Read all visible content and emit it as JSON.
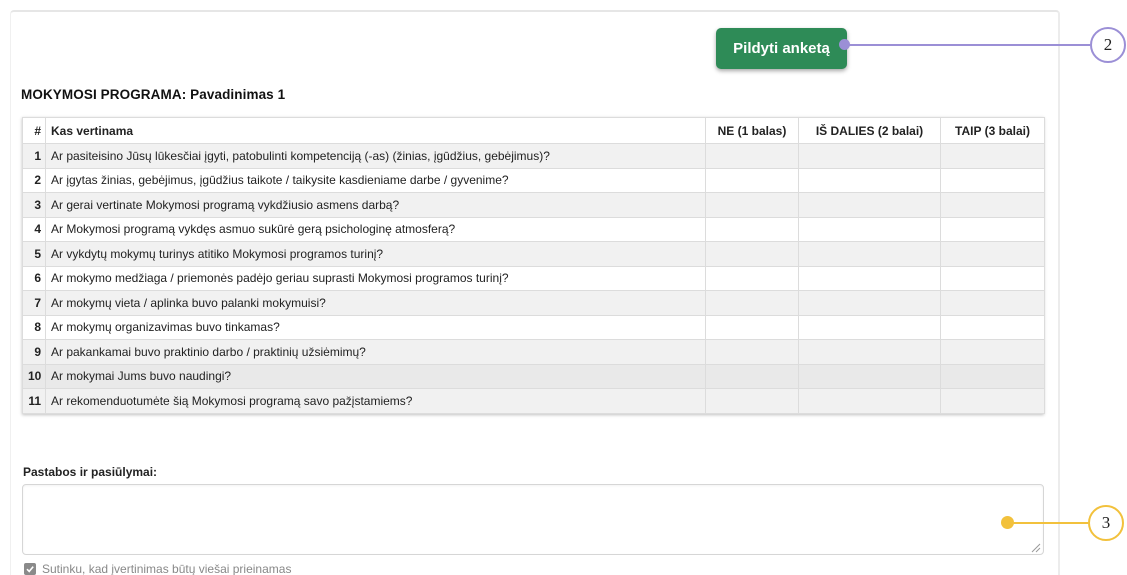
{
  "actions": {
    "fill_button_label": "Pildyti anketą"
  },
  "program": {
    "title": "MOKYMOSI PROGRAMA: Pavadinimas 1"
  },
  "table": {
    "headers": {
      "number": "#",
      "question": "Kas vertinama",
      "opt_no": "NE (1 balas)",
      "opt_partly": "IŠ DALIES (2 balai)",
      "opt_yes": "TAIP (3 balai)"
    },
    "rows": [
      {
        "n": "1",
        "q": "Ar pasiteisino Jūsų lūkesčiai įgyti, patobulinti kompetenciją (-as) (žinias, įgūdžius, gebėjimus)?"
      },
      {
        "n": "2",
        "q": "Ar įgytas žinias, gebėjimus, įgūdžius taikote / taikysite kasdieniame darbe / gyvenime?"
      },
      {
        "n": "3",
        "q": "Ar gerai vertinate Mokymosi programą vykdžiusio asmens darbą?"
      },
      {
        "n": "4",
        "q": "Ar Mokymosi programą vykdęs asmuo sukūrė gerą psichologinę atmosferą?"
      },
      {
        "n": "5",
        "q": "Ar vykdytų mokymų turinys atitiko Mokymosi programos turinį?"
      },
      {
        "n": "6",
        "q": "Ar mokymo medžiaga / priemonės padėjo geriau suprasti Mokymosi programos turinį?"
      },
      {
        "n": "7",
        "q": "Ar mokymų vieta / aplinka buvo palanki mokymuisi?"
      },
      {
        "n": "8",
        "q": "Ar mokymų organizavimas buvo tinkamas?"
      },
      {
        "n": "9",
        "q": "Ar pakankamai buvo praktinio darbo / praktinių užsiėmimų?"
      },
      {
        "n": "10",
        "q": "Ar mokymai Jums buvo naudingi?"
      },
      {
        "n": "11",
        "q": "Ar rekomenduotumėte šią Mokymosi programą savo pažįstamiems?"
      }
    ]
  },
  "comments": {
    "label": "Pastabos ir pasiūlymai:",
    "value": ""
  },
  "consent": {
    "label": "Sutinku, kad įvertinimas būtų viešai prieinamas",
    "checked": true
  },
  "annotations": {
    "callout_2": "2",
    "callout_3": "3",
    "callout_2_color": "#9b8fd6",
    "callout_3_color": "#f2c13c"
  },
  "colors": {
    "primary_button": "#2e8b57",
    "checkbox": "#8a8a8a"
  }
}
